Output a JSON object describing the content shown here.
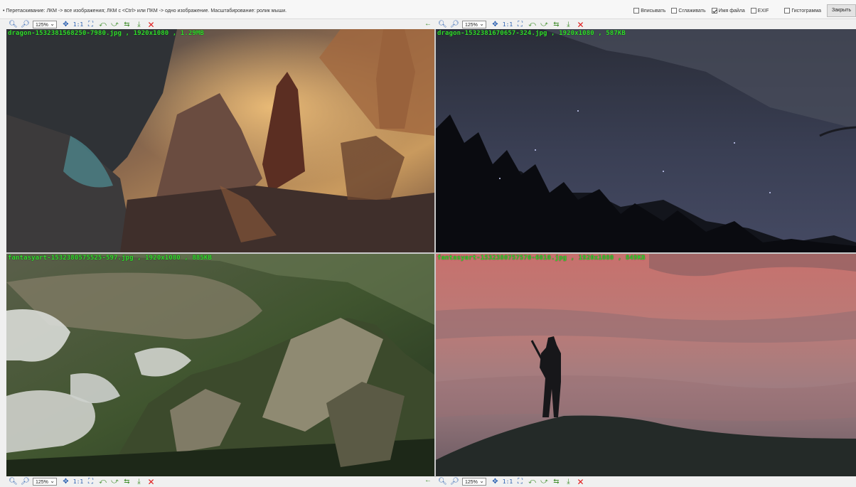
{
  "hint": "• Перетаскивание: ЛКМ -> все изображения; ЛКМ с <Ctrl> или ПКМ -> одно изображение. Масштабирование: ролик мыши.",
  "options": [
    {
      "label": "Вписывать",
      "checked": false
    },
    {
      "label": "Сглаживать",
      "checked": false
    },
    {
      "label": "Имя файла",
      "checked": true
    },
    {
      "label": "EXIF",
      "checked": false
    },
    {
      "label": "Гистограмма",
      "checked": false
    }
  ],
  "close_label": "Закрыть",
  "toolbar": {
    "zoom": "125%",
    "one_to_one": "1:1"
  },
  "images": [
    {
      "caption": "dragon-1532381568250-7980.jpg , 1920x1080 , 1.29MB"
    },
    {
      "caption": "dragon-1532381670657-324.jpg , 1920x1080 , 587KB"
    },
    {
      "caption": "fantasyart-1532380575525-597.jpg , 1920x1080 , 885KB"
    },
    {
      "caption": "fantasyart-1532380757570-6010.jpg , 1920x1080 , 849KB"
    }
  ],
  "colors": {
    "caption": "#31e02c",
    "close_icon": "#e01b1b",
    "zoom_icon": "#2a5fb0"
  }
}
